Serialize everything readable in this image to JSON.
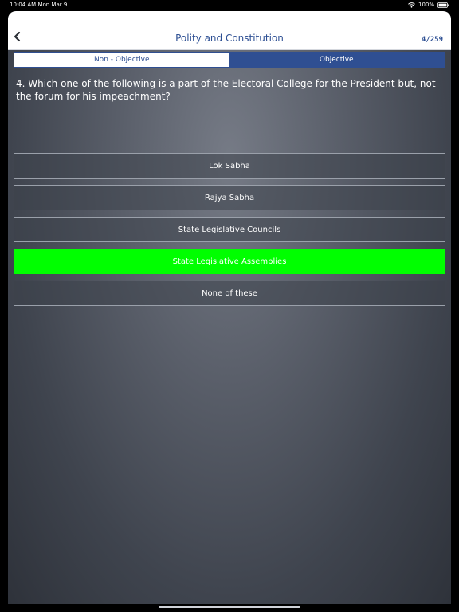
{
  "status_bar": {
    "time_date": "10:04 AM  Mon Mar 9",
    "battery": "100%",
    "wifi_icon": "wifi-icon",
    "battery_icon": "battery-icon"
  },
  "nav": {
    "back_icon": "chevron-left-icon",
    "title": "Polity and Constitution",
    "counter": "4/259"
  },
  "tabs": [
    {
      "label": "Non - Objective",
      "selected": false
    },
    {
      "label": "Objective",
      "selected": true
    }
  ],
  "question": {
    "text": "4. Which one of the following is a part of the Electoral College for the President but, not the forum for his impeachment?"
  },
  "options": [
    {
      "label": "Lok Sabha",
      "correct": false
    },
    {
      "label": "Rajya Sabha",
      "correct": false
    },
    {
      "label": "State Legislative Councils",
      "correct": false
    },
    {
      "label": "State Legislative Assemblies",
      "correct": true
    },
    {
      "label": "None of these",
      "correct": false
    }
  ],
  "colors": {
    "accent": "#2f4f92",
    "correct": "#00ff00"
  }
}
